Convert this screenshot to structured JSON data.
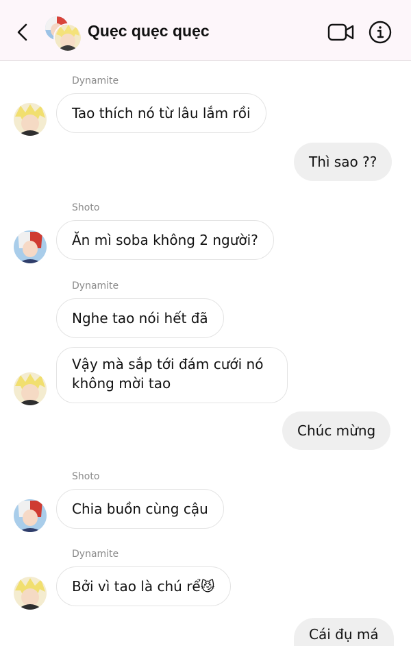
{
  "header": {
    "title": "Quẹc quẹc quẹc",
    "icons": [
      "back-chevron-icon",
      "video-call-icon",
      "info-icon"
    ]
  },
  "messages": [
    {
      "sender": "Dynamite",
      "text": "Tao thích nó từ lâu lắm rồi",
      "direction": "in"
    },
    {
      "text": "Thì sao ??",
      "direction": "out"
    },
    {
      "sender": "Shoto",
      "text": "Ăn mì soba không 2 người?",
      "direction": "in"
    },
    {
      "sender": "Dynamite",
      "text": "Nghe tao nói hết đã",
      "direction": "in"
    },
    {
      "text": "Vậy mà sắp tới đám cưới nó không mời tao",
      "direction": "in"
    },
    {
      "text": "Chúc mừng",
      "direction": "out"
    },
    {
      "sender": "Shoto",
      "text": "Chia buồn cùng cậu",
      "direction": "in"
    },
    {
      "sender": "Dynamite",
      "text": "Bởi vì tao là chú rể",
      "emoji": "😼",
      "direction": "in"
    },
    {
      "text": "Cái đụ má",
      "direction": "out"
    }
  ],
  "colors": {
    "header_bg": "#fdf6fa",
    "incoming_bubble": "#ffffff",
    "outgoing_bubble": "#efefef",
    "sender_label": "#8a8a8a"
  }
}
